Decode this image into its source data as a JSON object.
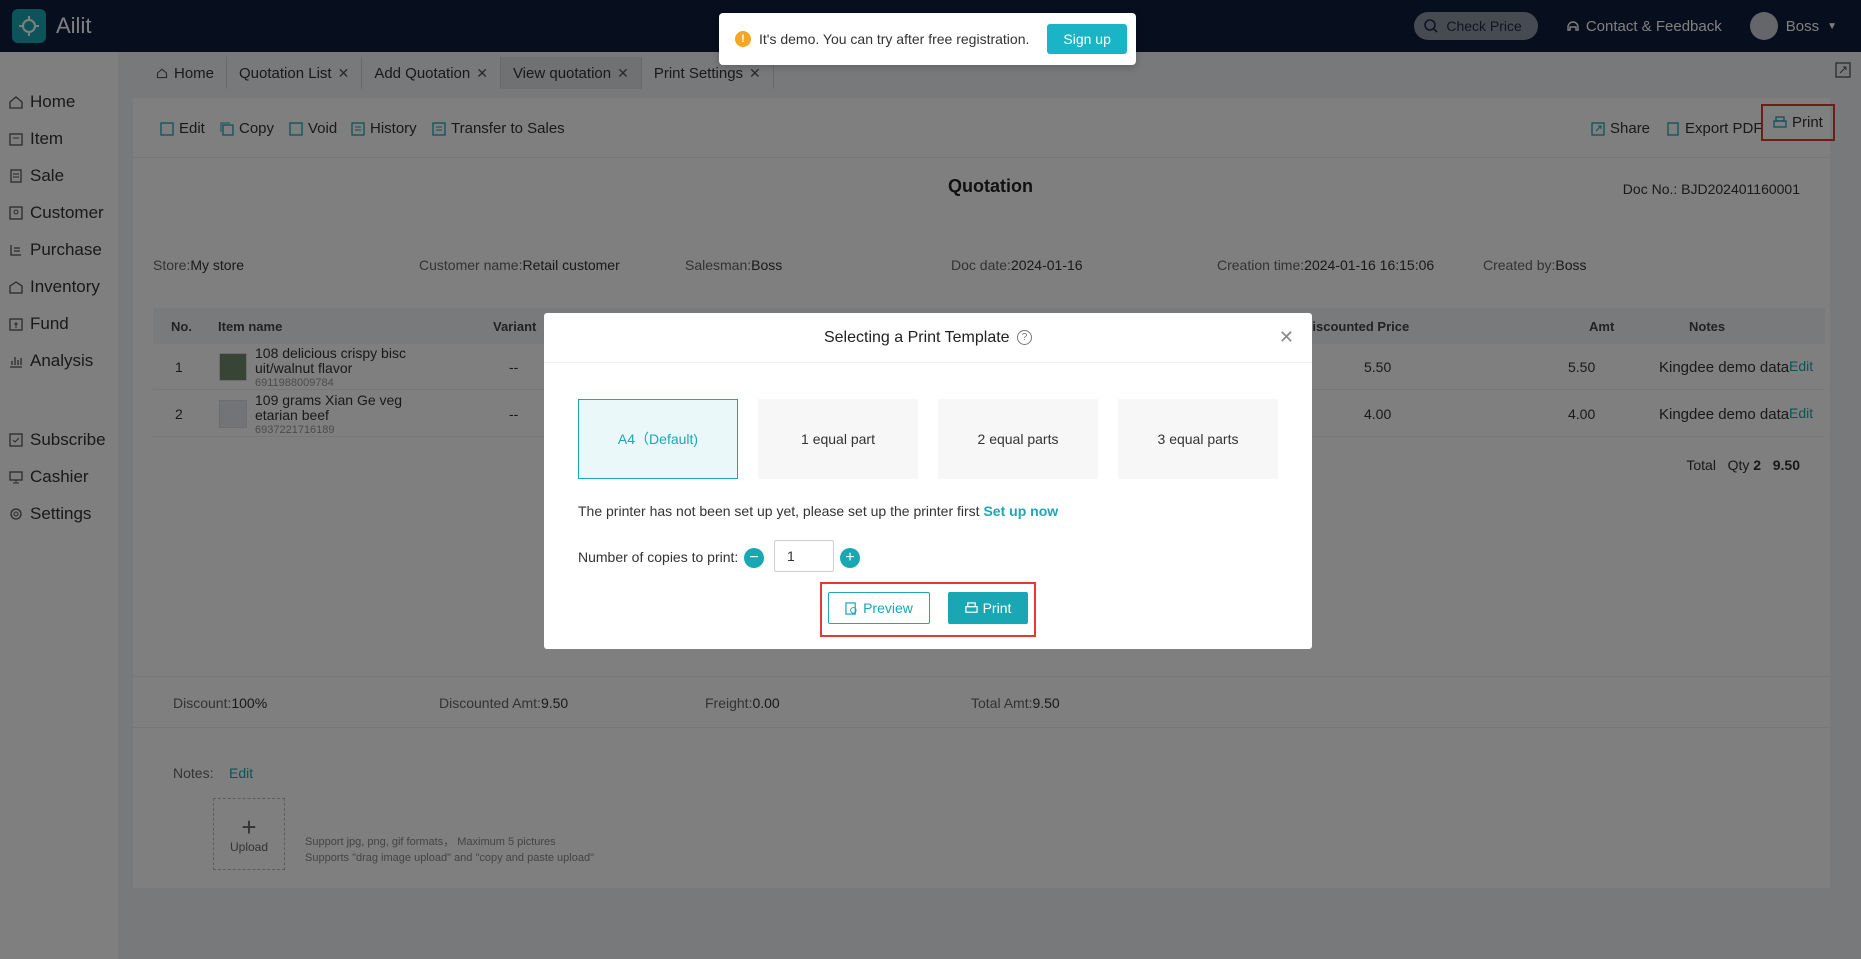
{
  "app": {
    "name": "Ailit"
  },
  "topbar": {
    "check_price": "Check Price",
    "contact": "Contact & Feedback",
    "user": "Boss"
  },
  "sidebar": {
    "items": [
      {
        "label": "Home",
        "icon": "home-icon"
      },
      {
        "label": "Item",
        "icon": "item-icon"
      },
      {
        "label": "Sale",
        "icon": "sale-icon"
      },
      {
        "label": "Customer",
        "icon": "customer-icon"
      },
      {
        "label": "Purchase",
        "icon": "purchase-icon"
      },
      {
        "label": "Inventory",
        "icon": "inventory-icon"
      },
      {
        "label": "Fund",
        "icon": "fund-icon"
      },
      {
        "label": "Analysis",
        "icon": "analysis-icon"
      },
      {
        "label": "Subscribe",
        "icon": "subscribe-icon"
      },
      {
        "label": "Cashier",
        "icon": "cashier-icon"
      },
      {
        "label": "Settings",
        "icon": "settings-icon"
      }
    ]
  },
  "tabs": [
    {
      "label": "Home"
    },
    {
      "label": "Quotation List"
    },
    {
      "label": "Add Quotation"
    },
    {
      "label": "View quotation"
    },
    {
      "label": "Print Settings"
    }
  ],
  "toolbar": {
    "edit": "Edit",
    "copy": "Copy",
    "void": "Void",
    "history": "History",
    "transfer": "Transfer to Sales",
    "share": "Share",
    "export_pdf": "Export PDF",
    "print": "Print"
  },
  "doc": {
    "title": "Quotation",
    "doc_no_label": "Doc No.:",
    "doc_no": "BJD202401160001",
    "store_label": "Store:",
    "store": "My store",
    "customer_label": "Customer name:",
    "customer": "Retail customer",
    "salesman_label": "Salesman:",
    "salesman": "Boss",
    "date_label": "Doc date:",
    "date": "2024-01-16",
    "created_label": "Creation time:",
    "created": "2024-01-16 16:15:06",
    "createdby_label": "Created by:",
    "createdby": "Boss"
  },
  "table": {
    "headers": {
      "no": "No.",
      "item": "Item name",
      "variant": "Variant",
      "disc_price": "Discounted Price",
      "amt": "Amt",
      "notes": "Notes"
    },
    "rows": [
      {
        "no": "1",
        "name1": "108 delicious crispy bisc",
        "name2": "uit/walnut flavor",
        "barcode": "6911988009784",
        "variant": "--",
        "disc_price": "5.50",
        "amt": "5.50",
        "notes": "Kingdee demo data",
        "edit": "Edit"
      },
      {
        "no": "2",
        "name1": "109 grams Xian Ge veg",
        "name2": "etarian beef",
        "barcode": "6937221716189",
        "variant": "--",
        "disc_price": "4.00",
        "amt": "4.00",
        "notes": "Kingdee demo data",
        "edit": "Edit"
      }
    ],
    "total_label": "Total",
    "qty_label": "Qty",
    "qty": "2",
    "total": "9.50"
  },
  "summary": {
    "discount_label": "Discount:",
    "discount": "100%",
    "disc_amt_label": "Discounted Amt:",
    "disc_amt": "9.50",
    "freight_label": "Freight:",
    "freight": "0.00",
    "total_label": "Total Amt:",
    "total": "9.50"
  },
  "notes": {
    "label": "Notes:",
    "edit": "Edit",
    "upload": "Upload",
    "hint1": "Support jpg, png, gif formats， Maximum 5 pictures",
    "hint2": "Supports \"drag image upload\" and \"copy and paste upload\""
  },
  "demo": {
    "text": "It's demo. You can try after free registration.",
    "signup": "Sign up"
  },
  "dialog": {
    "title": "Selecting a Print Template",
    "templates": [
      "A4（Default)",
      "1 equal part",
      "2 equal parts",
      "3 equal parts"
    ],
    "printer_msg": "The printer has not been set up yet, please set up the printer first",
    "setup": "Set up now",
    "copies_label": "Number of copies to print:",
    "copies": "1",
    "preview": "Preview",
    "print": "Print"
  }
}
